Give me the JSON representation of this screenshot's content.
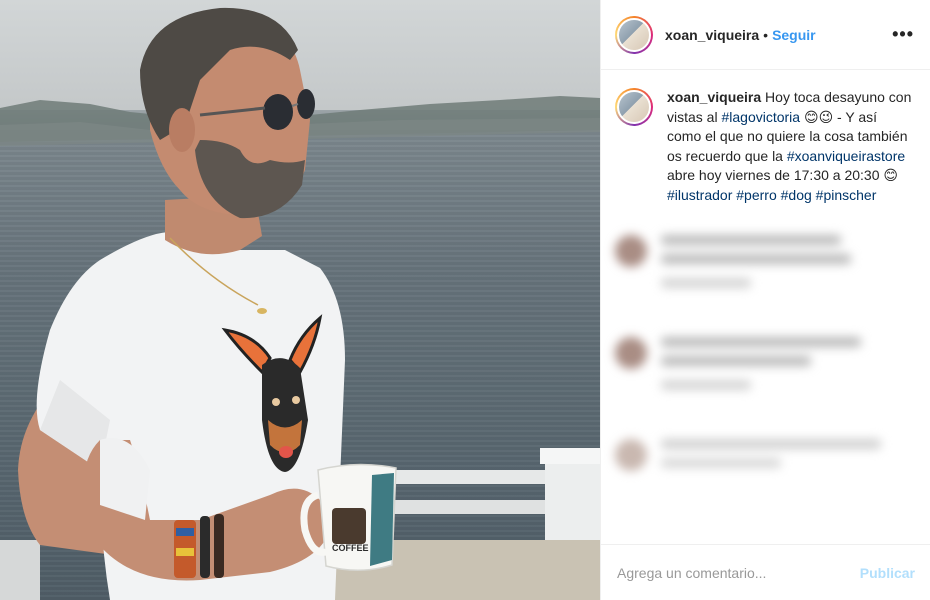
{
  "post": {
    "username": "xoan_viqueira",
    "separator": "•",
    "follow_label": "Seguir",
    "more_label": "•••"
  },
  "caption": {
    "username": "xoan_viqueira",
    "text_1": " Hoy toca desayuno con vistas al ",
    "tag_1": "#lagovictoria",
    "text_2": " 😊😉 - Y así como el que no quiere la cosa también os recuerdo que la ",
    "tag_2": "#xoanviqueirastore",
    "text_3": " abre hoy viernes de 17:30 a 20:30 😊 ",
    "tag_3": "#ilustrador",
    "tag_4": "#perro",
    "tag_5": "#dog",
    "tag_6": "#pinscher"
  },
  "comment_box": {
    "placeholder": "Agrega un comentario...",
    "publish_label": "Publicar"
  },
  "mug_text": {
    "coffee": "COFFEE"
  },
  "colors": {
    "accent": "#3897f0",
    "hashtag": "#003569",
    "publish_disabled": "#b2dffc"
  }
}
